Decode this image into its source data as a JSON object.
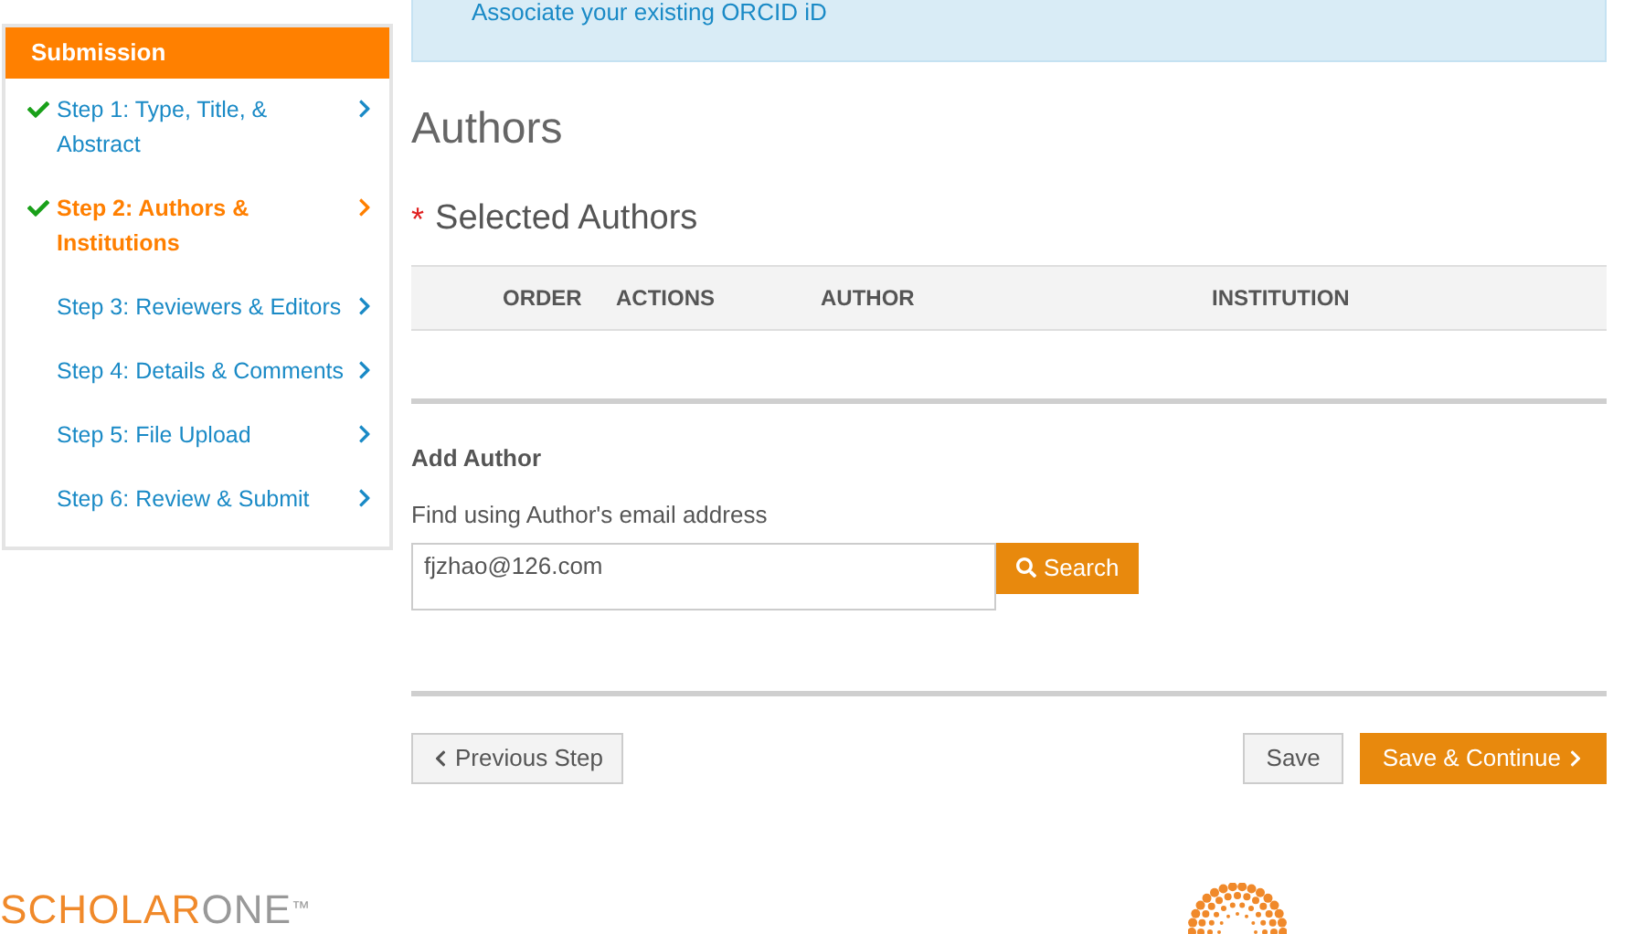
{
  "banner": {
    "link": "Associate your existing ORCID iD"
  },
  "sidebar": {
    "title": "Submission",
    "steps": [
      {
        "label": "Step 1: Type, Title, & Abstract",
        "completed": true,
        "selected": false
      },
      {
        "label": "Step 2: Authors & Institutions",
        "completed": true,
        "selected": true
      },
      {
        "label": "Step 3: Reviewers & Editors",
        "completed": false,
        "selected": false
      },
      {
        "label": "Step 4: Details & Comments",
        "completed": false,
        "selected": false
      },
      {
        "label": "Step 5: File Upload",
        "completed": false,
        "selected": false
      },
      {
        "label": "Step 6: Review & Submit",
        "completed": false,
        "selected": false
      }
    ]
  },
  "page_title": "Authors",
  "selected_authors": {
    "required_mark": "*",
    "title": "Selected Authors",
    "columns": [
      "ORDER",
      "ACTIONS",
      "AUTHOR",
      "INSTITUTION"
    ]
  },
  "add_author": {
    "title": "Add Author",
    "label": "Find using Author's email address",
    "value": "fjzhao@126.com",
    "button": "Search"
  },
  "footer_buttons": {
    "previous": "Previous Step",
    "save": "Save",
    "save_continue": "Save & Continue"
  },
  "logo": {
    "part_1": "SCHOLAR",
    "part_2": "ONE",
    "mark": "™"
  }
}
